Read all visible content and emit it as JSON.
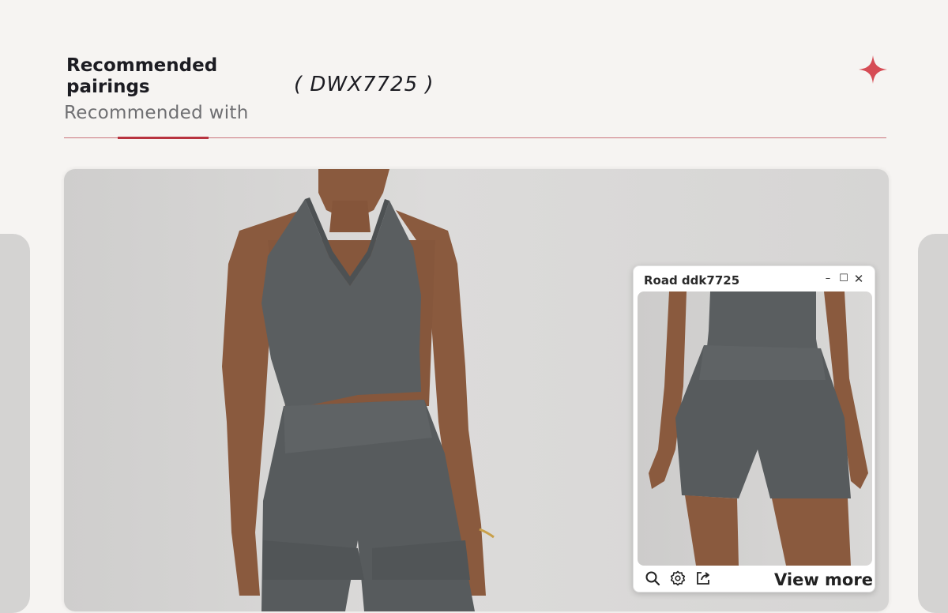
{
  "header": {
    "title": "Recommended pairings",
    "subtitle": "Recommended with",
    "model_code": "( DWX7725 )"
  },
  "colors": {
    "accent": "#b8333f",
    "divider": "#c9727a",
    "sparkle": "#d64c55",
    "garment": "#5a5e60",
    "skin": "#8a5a3e",
    "background": "#f6f4f2"
  },
  "icons": {
    "sparkle": "four-point-star-icon",
    "minimize": "minimize-icon",
    "maximize": "maximize-icon",
    "close": "close-icon",
    "zoom": "zoom-icon",
    "settings": "gear-icon",
    "share": "share-icon"
  },
  "popup": {
    "title": "Road ddk7725",
    "minimize_symbol": "–",
    "maximize_symbol": "☐",
    "close_symbol": "✕",
    "view_more_label": "View more"
  }
}
